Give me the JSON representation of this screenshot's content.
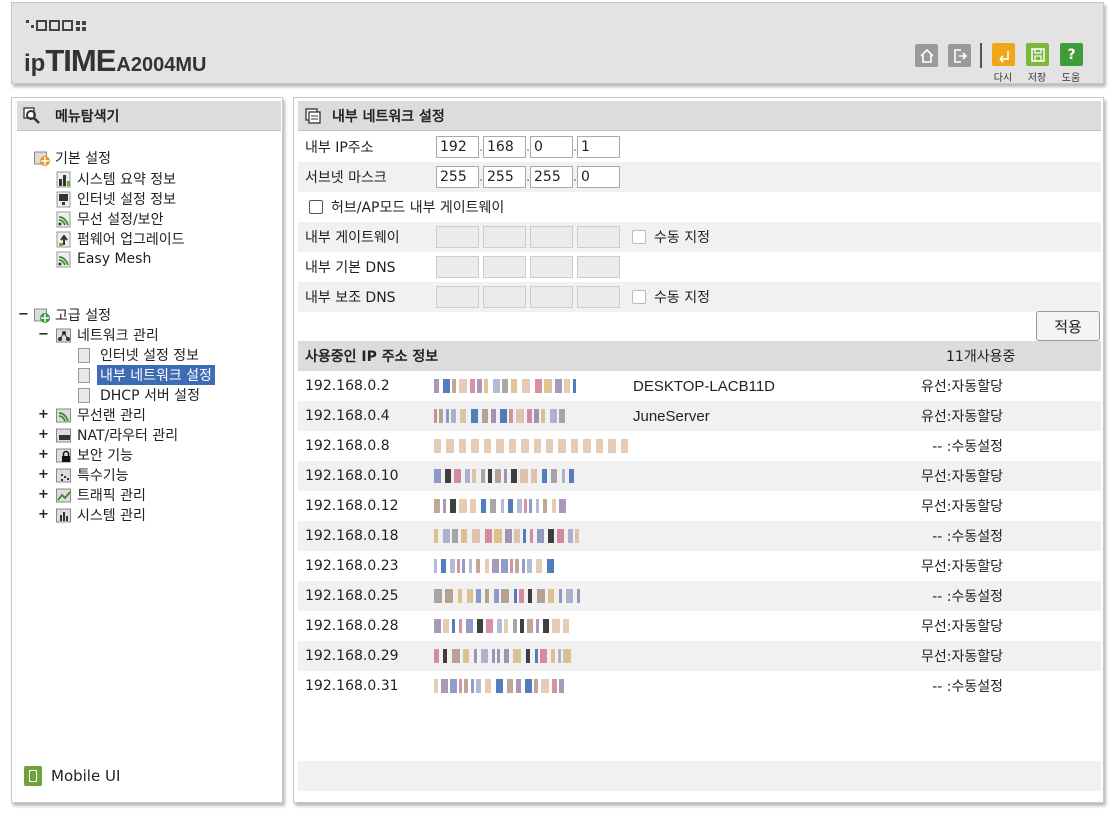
{
  "header": {
    "brand_small": "▪.▫▫▫▫",
    "brand_ip": "ip",
    "brand_time": "TIME",
    "model": "A2004MU",
    "buttons": [
      {
        "name": "home",
        "label": ""
      },
      {
        "name": "logout",
        "label": ""
      },
      {
        "name": "reset",
        "label": "다시"
      },
      {
        "name": "save",
        "label": "저장"
      },
      {
        "name": "help",
        "label": "도움"
      }
    ]
  },
  "sidebar": {
    "title": "메뉴탐색기",
    "basic": {
      "label": "기본 설정",
      "items": [
        "시스템 요약 정보",
        "인터넷 설정 정보",
        "무선 설정/보안",
        "펌웨어 업그레이드",
        "Easy Mesh"
      ]
    },
    "advanced": {
      "label": "고급 설정",
      "network": {
        "label": "네트워크 관리",
        "items": [
          "인터넷 설정 정보",
          "내부 네트워크 설정",
          "DHCP 서버 설정"
        ],
        "selected_index": 1
      },
      "others": [
        "무선랜 관리",
        "NAT/라우터 관리",
        "보안 기능",
        "특수기능",
        "트래픽 관리",
        "시스템 관리"
      ]
    },
    "mobile_ui": "Mobile UI"
  },
  "main": {
    "title": "내부 네트워크 설정",
    "internal_ip": {
      "label": "내부 IP주소",
      "octets": [
        "192",
        "168",
        "0",
        "1"
      ]
    },
    "subnet_mask": {
      "label": "서브넷 마스크",
      "octets": [
        "255",
        "255",
        "255",
        "0"
      ]
    },
    "hub_ap_mode": {
      "label": "허브/AP모드 내부 게이트웨이",
      "checked": false
    },
    "gateway": {
      "label": "내부 게이트웨이",
      "manual_label": "수동 지정"
    },
    "dns_primary": {
      "label": "내부 기본 DNS"
    },
    "dns_secondary": {
      "label": "내부 보조 DNS",
      "manual_label": "수동 지정"
    },
    "apply_label": "적용",
    "ip_table": {
      "title": "사용중인 IP 주소 정보",
      "count_label": "11개사용중",
      "rows": [
        {
          "ip": "192.168.0.2",
          "name": "DESKTOP-LACB11D",
          "status": "유선:자동할당"
        },
        {
          "ip": "192.168.0.4",
          "name": "JuneServer",
          "status": "유선:자동할당"
        },
        {
          "ip": "192.168.0.8",
          "name": "",
          "status": "-- :수동설정"
        },
        {
          "ip": "192.168.0.10",
          "name": "",
          "status": "무선:자동할당"
        },
        {
          "ip": "192.168.0.12",
          "name": "",
          "status": "무선:자동할당"
        },
        {
          "ip": "192.168.0.18",
          "name": "",
          "status": "-- :수동설정"
        },
        {
          "ip": "192.168.0.23",
          "name": "",
          "status": "무선:자동할당"
        },
        {
          "ip": "192.168.0.25",
          "name": "",
          "status": "-- :수동설정"
        },
        {
          "ip": "192.168.0.28",
          "name": "",
          "status": "무선:자동할당"
        },
        {
          "ip": "192.168.0.29",
          "name": "",
          "status": "무선:자동할당"
        },
        {
          "ip": "192.168.0.31",
          "name": "",
          "status": "-- :수동설정"
        }
      ]
    }
  }
}
